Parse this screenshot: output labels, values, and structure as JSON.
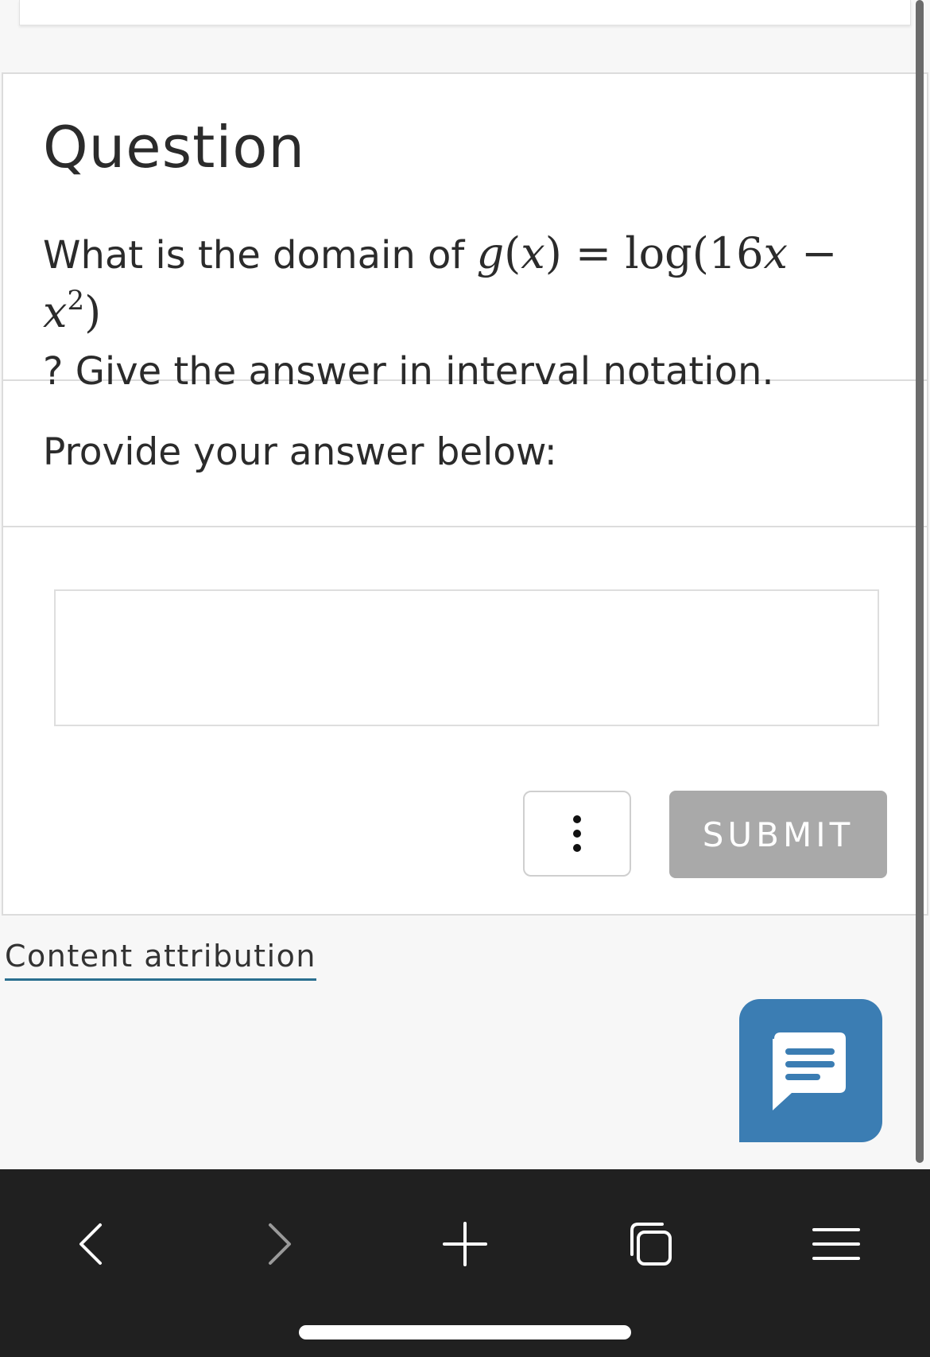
{
  "question": {
    "heading": "Question",
    "text_before": "What is the domain of ",
    "math": {
      "lhs_func": "g",
      "lhs_var": "x",
      "equals": "=",
      "log": "log",
      "coef": "16",
      "var": "x",
      "minus": "−",
      "exponent": "2"
    },
    "text_after": "? Give the answer in interval notation."
  },
  "answer": {
    "prompt": "Provide your answer below:",
    "input_value": "",
    "input_placeholder": ""
  },
  "actions": {
    "submit_label": "SUBMIT"
  },
  "footer": {
    "attribution_link": "Content attribution"
  },
  "colors": {
    "chat_button": "#3b7db3",
    "submit_disabled": "#a9a9a9",
    "attribution_underline": "#2a6f8f",
    "browser_bar": "#202020"
  },
  "icons": {
    "more": "vertical-ellipsis-icon",
    "chat": "chat-bubble-icon",
    "back": "chevron-left-icon",
    "forward": "chevron-right-icon",
    "new_tab": "plus-icon",
    "tabs": "tabs-icon",
    "menu": "hamburger-menu-icon"
  }
}
